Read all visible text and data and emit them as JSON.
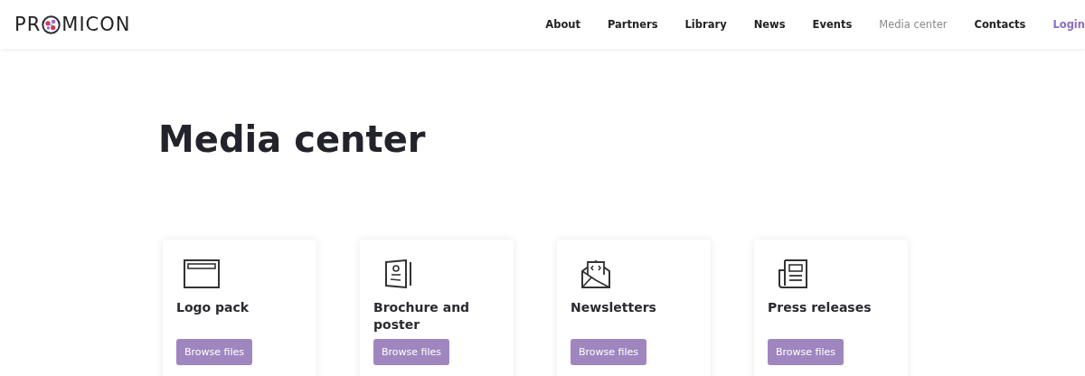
{
  "logo": {
    "before": "PR",
    "after": "MICON"
  },
  "nav": [
    {
      "label": "About",
      "kind": "link",
      "selected": false
    },
    {
      "label": "Partners",
      "kind": "link",
      "selected": false
    },
    {
      "label": "Library",
      "kind": "link",
      "selected": false
    },
    {
      "label": "News",
      "kind": "link",
      "selected": false
    },
    {
      "label": "Events",
      "kind": "link",
      "selected": false
    },
    {
      "label": "Media center",
      "kind": "link",
      "selected": true
    },
    {
      "label": "Contacts",
      "kind": "link",
      "selected": false
    },
    {
      "label": "Login",
      "kind": "login",
      "selected": false
    }
  ],
  "heading": "Media center",
  "cards": [
    {
      "kind": "window",
      "title": "Logo pack",
      "button": "Browse files"
    },
    {
      "kind": "brochure",
      "title": "Brochure and poster",
      "button": "Browse files"
    },
    {
      "kind": "envelope",
      "title": "Newsletters",
      "button": "Browse files"
    },
    {
      "kind": "newspaper",
      "title": "Press releases",
      "button": "Browse files"
    }
  ]
}
